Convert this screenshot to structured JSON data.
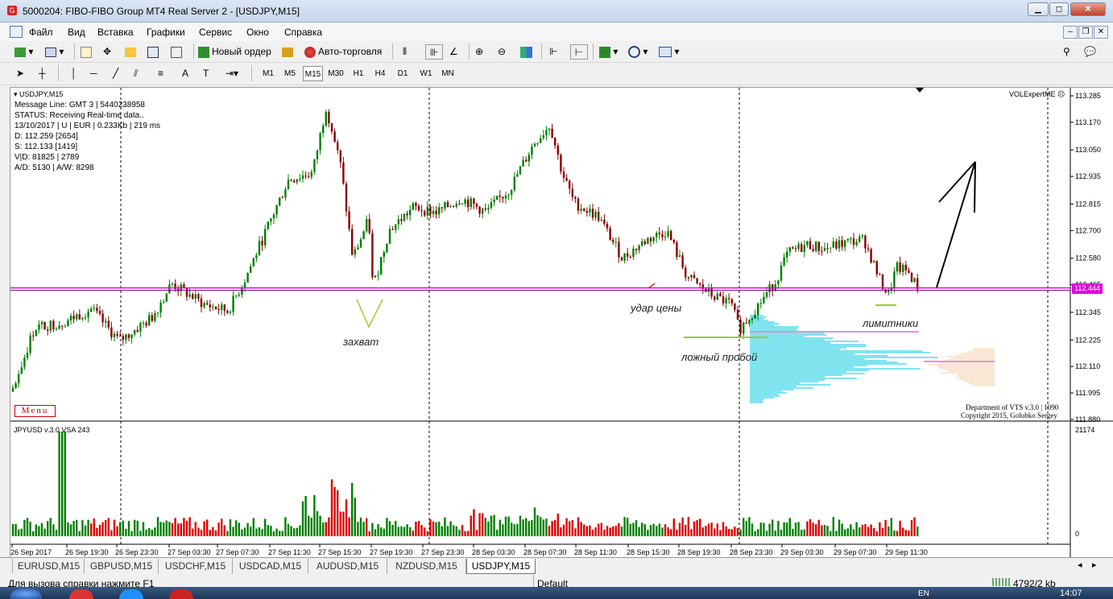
{
  "window": {
    "title": "5000204: FIBO-FIBO Group MT4 Real Server 2 - [USDJPY,M15]",
    "app_icon": "mt4-logo-icon"
  },
  "menu": [
    "Файл",
    "Вид",
    "Вставка",
    "Графики",
    "Сервис",
    "Окно",
    "Справка"
  ],
  "toolbar": {
    "new_order": "Новый ордер",
    "auto_trading": "Авто-торговля"
  },
  "timeframes": [
    "M1",
    "M5",
    "M15",
    "M30",
    "H1",
    "H4",
    "D1",
    "W1",
    "MN"
  ],
  "selected_timeframe": "M15",
  "chart": {
    "symbol": "USDJPY,M15",
    "info_lines": [
      "Message Line: GMT 3 | 5440238958",
      "STATUS:  Receiving Real-time data..",
      "13/10/2017 | U | EUR | 0.233Kb | 219 ms",
      "D: 112.259  [2654]",
      "S: 112.133  [1419]",
      "V|D: 81825 | 2789",
      "A/D: 5130 | A/W: 8298"
    ],
    "indicator_label": "VOLExpertME",
    "current_price": "112.444",
    "menu_button": "Menu",
    "copyright_lines": [
      "Department of VTS  v.3.0 | 1090",
      "Copyright 2015, Golubko Sergey"
    ],
    "price_ticks": [
      "113.285",
      "113.170",
      "113.050",
      "112.935",
      "112.815",
      "112.700",
      "112.580",
      "112.465",
      "112.345",
      "112.225",
      "112.110",
      "111.995",
      "111.880"
    ],
    "annotations": {
      "capture": "захват",
      "price_hit": "удар цены",
      "false_breakout": "ложный пробой",
      "limit_orders": "лимитники"
    },
    "volume_panel": {
      "label": "JPYUSD v.3.0 VSA 243",
      "max": "21174",
      "min": "0"
    },
    "time_ticks": [
      "26 Sep 2017",
      "26 Sep 19:30",
      "26 Sep 23:30",
      "27 Sep 03:30",
      "27 Sep 07:30",
      "27 Sep 11:30",
      "27 Sep 15:30",
      "27 Sep 19:30",
      "27 Sep 23:30",
      "28 Sep 03:30",
      "28 Sep 07:30",
      "28 Sep 11:30",
      "28 Sep 15:30",
      "28 Sep 19:30",
      "28 Sep 23:30",
      "29 Sep 03:30",
      "29 Sep 07:30",
      "29 Sep 11:30"
    ],
    "colors": {
      "bull": "#008000",
      "bear": "#8b0000",
      "level": "#e000e0",
      "profile": "#00c8dc",
      "vol_up": "#008000",
      "vol_down": "#e00000"
    }
  },
  "tabs": [
    "EURUSD,M15",
    "GBPUSD,M15",
    "USDCHF,M15",
    "USDCAD,M15",
    "AUDUSD,M15",
    "NZDUSD,M15",
    "USDJPY,M15"
  ],
  "active_tab": "USDJPY,M15",
  "status": {
    "help": "Для вызова справки нажмите F1",
    "profile": "Default",
    "traffic": "4792/2 kb"
  },
  "taskbar": {
    "clock": "14:07",
    "lang": "EN"
  }
}
